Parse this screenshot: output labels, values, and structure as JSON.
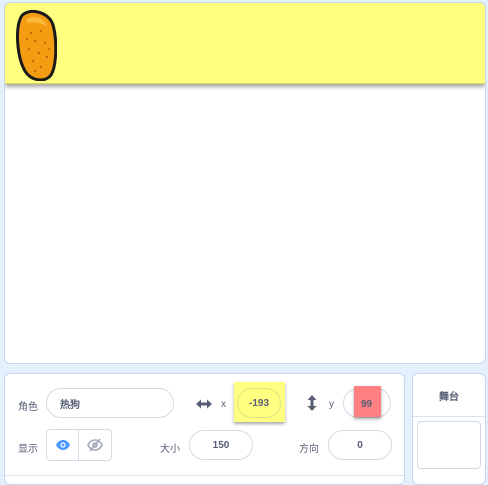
{
  "sprite_info": {
    "sprite_label": "角色",
    "sprite_name": "热狗",
    "x_label": "x",
    "x_value": "-193",
    "y_label": "y",
    "y_value": "99",
    "show_label": "显示",
    "size_label": "大小",
    "size_value": "150",
    "direction_label": "方向",
    "direction_value": "0"
  },
  "stage_panel": {
    "title": "舞台"
  },
  "colors": {
    "banner": "#ffff80",
    "x_highlight": "#ffff80",
    "y_highlight": "#ff8080",
    "eye_active": "#4c97ff"
  },
  "icons": [
    "hotdog-sprite",
    "horizontal-arrow-icon",
    "vertical-arrow-icon",
    "eye-icon",
    "eye-slash-icon"
  ]
}
